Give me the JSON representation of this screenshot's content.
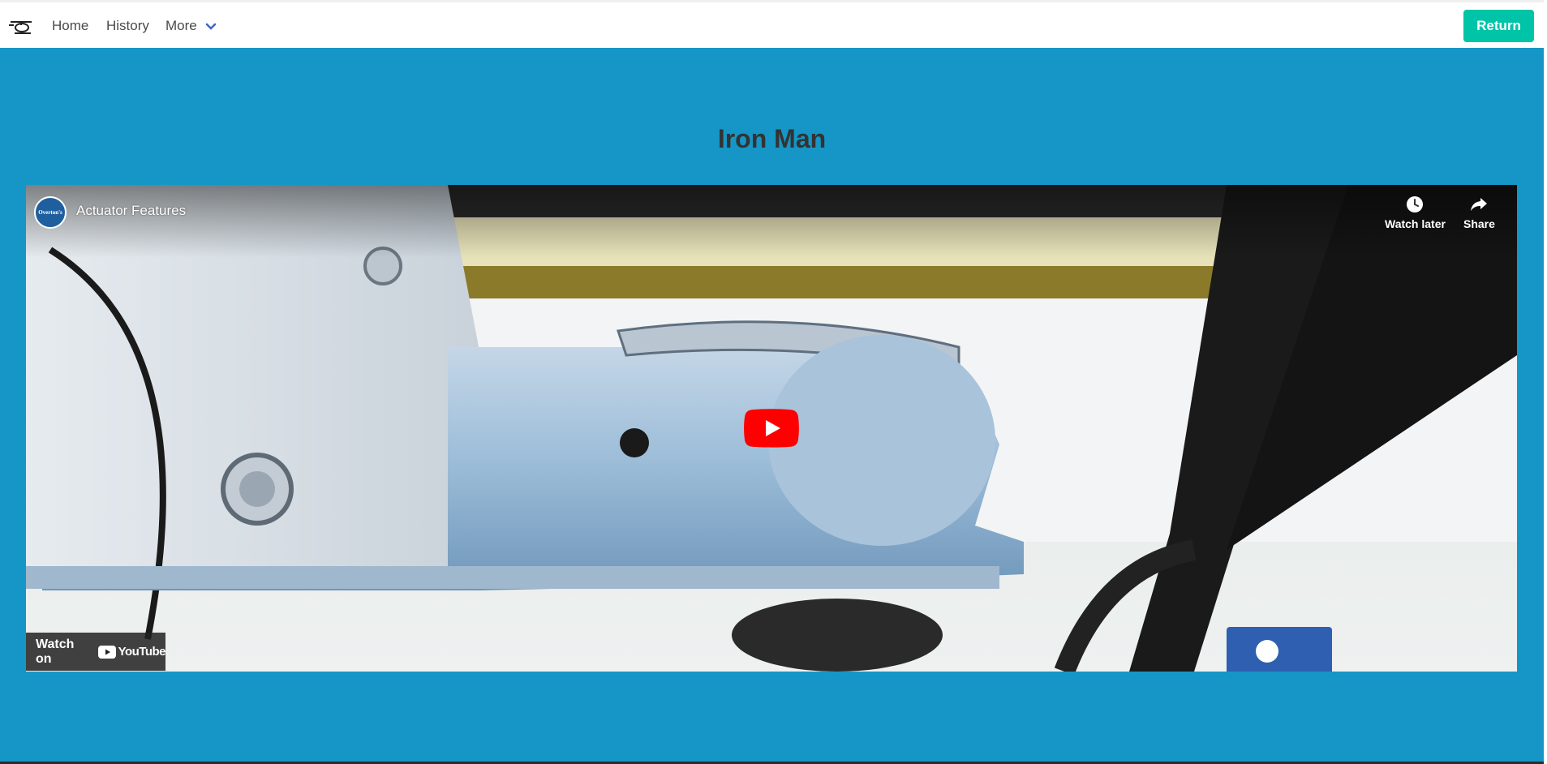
{
  "nav": {
    "home_label": "Home",
    "history_label": "History",
    "more_label": "More",
    "return_label": "Return"
  },
  "page": {
    "title": "Iron Man"
  },
  "video": {
    "channel_badge": "Overton's",
    "title": "Actuator Features",
    "watch_later_label": "Watch later",
    "share_label": "Share",
    "watch_on_label": "Watch on",
    "youtube_label": "YouTube"
  },
  "colors": {
    "background": "#1596c6",
    "return_button": "#00c4a7",
    "play_button": "#ff0000"
  }
}
